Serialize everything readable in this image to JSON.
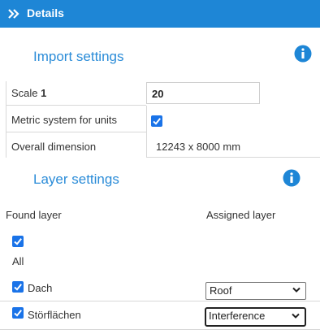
{
  "header": {
    "title": "Details"
  },
  "import": {
    "title": "Import settings",
    "scale_label": "Scale",
    "scale_number": "1",
    "scale_value": "20",
    "metric_label": "Metric system for units",
    "metric_checked": true,
    "overall_label": "Overall dimension",
    "overall_value": "12243 x 8000 mm"
  },
  "layers": {
    "title": "Layer settings",
    "col_found": "Found layer",
    "col_assigned": "Assigned layer",
    "all_label": "All",
    "rows": [
      {
        "name": "Dach",
        "assigned": "Roof",
        "checked": true
      },
      {
        "name": "Störflächen",
        "assigned": "Interference",
        "checked": true
      }
    ]
  },
  "colors": {
    "header_bg": "#1e86d6",
    "accent": "#2b8cd8",
    "checkbox": "#1a73e8"
  }
}
